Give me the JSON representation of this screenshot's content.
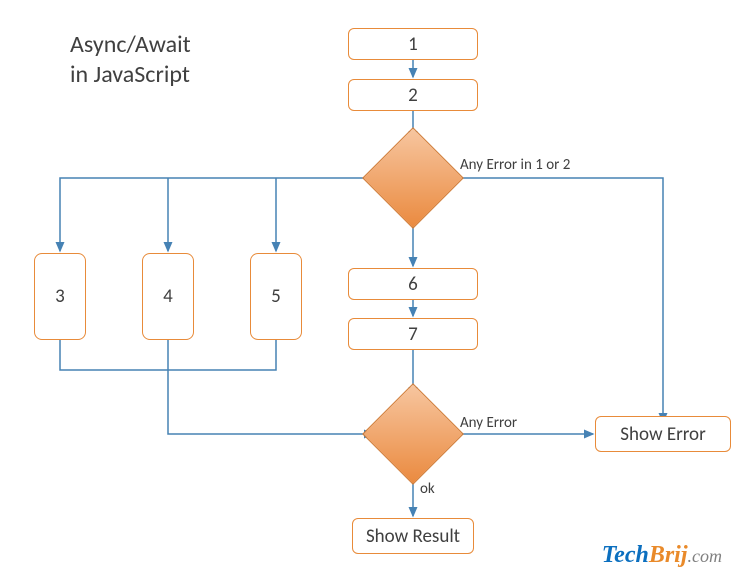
{
  "title_line1": "Async/Await",
  "title_line2": "in JavaScript",
  "nodes": {
    "n1": "1",
    "n2": "2",
    "n3": "3",
    "n4": "4",
    "n5": "5",
    "n6": "6",
    "n7": "7",
    "show_result": "Show Result",
    "show_error": "Show Error"
  },
  "labels": {
    "err12": "Any Error in 1 or 2",
    "any_error": "Any Error",
    "ok": "ok"
  },
  "branding": {
    "part1": "Tech",
    "part2": "Brij",
    "part3": ".com"
  },
  "colors": {
    "arrow": "#4682b4",
    "node_border": "#e88b3a",
    "diamond_fill1": "#f7c6a0",
    "diamond_fill2": "#ea8a3f"
  }
}
